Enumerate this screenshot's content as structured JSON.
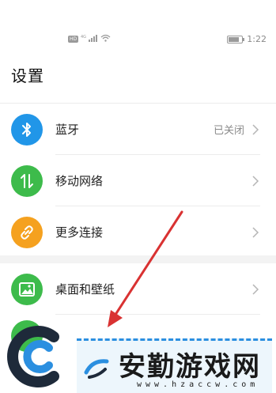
{
  "status_bar": {
    "hd_badge": "HD",
    "signal_label": "4G",
    "time": "1:22",
    "battery_level": 0.8,
    "wifi_icon": "wifi-icon",
    "signal_icon": "signal-icon"
  },
  "page": {
    "title": "设置"
  },
  "settings": {
    "group1": [
      {
        "label": "蓝牙",
        "value": "已关闭",
        "icon": "bluetooth-icon",
        "color": "#2196e8"
      },
      {
        "label": "移动网络",
        "value": "",
        "icon": "mobile-network-icon",
        "color": "#3dbb4b"
      },
      {
        "label": "更多连接",
        "value": "",
        "icon": "link-icon",
        "color": "#f5a11f"
      }
    ],
    "group2": [
      {
        "label": "桌面和壁纸",
        "value": "",
        "icon": "wallpaper-icon",
        "color": "#3dbb4b"
      }
    ]
  },
  "watermark": {
    "title": "安勤游戏网",
    "url": "www.hzaccw.com"
  },
  "colors": {
    "annotation_arrow": "#d93232",
    "bluetooth": "#2196e8",
    "network": "#3dbb4b",
    "connections": "#f5a11f",
    "wallpaper": "#3dbb4b"
  }
}
